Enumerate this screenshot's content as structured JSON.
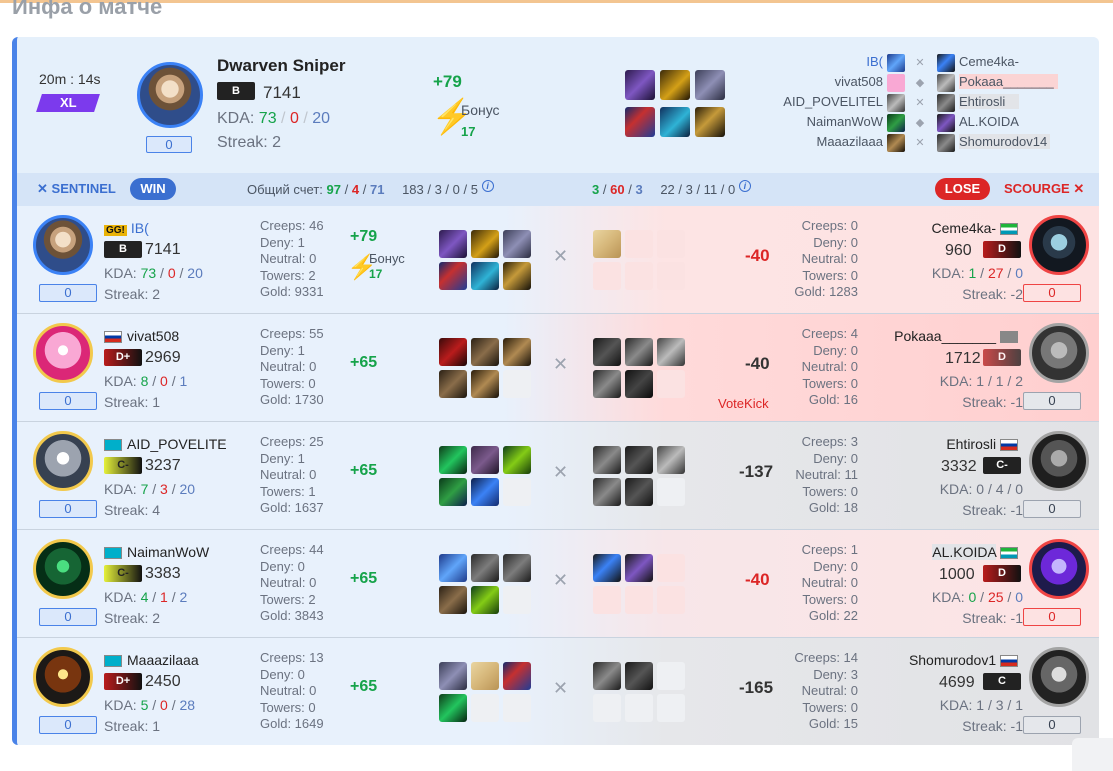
{
  "page_title": "Инфа о матче",
  "summary": {
    "time": "20m : 14s",
    "xl_badge": "XL",
    "hero_name": "Dwarven Sniper",
    "rank_letter": "B",
    "mmr": "7141",
    "kda_label": "KDA:",
    "kda_k": "73",
    "kda_d": "0",
    "kda_a": "20",
    "sep": "/",
    "streak": "Streak: 2",
    "value_box": "0",
    "delta": "+79",
    "bonus_label": "Бонус",
    "bonus_value": "17"
  },
  "roster": {
    "left": [
      "IB(",
      "vivat508",
      "AID_POVELITEL",
      "NaimanWoW",
      "Maaazilaaa"
    ],
    "right": [
      "Ceme4ka-",
      "Pokaaa_______",
      "Ehtirosli",
      "AL.KOIDA",
      "Shomurodov14"
    ]
  },
  "teambar": {
    "left_team": "SENTINEL",
    "win": "WIN",
    "total_label": "Общий счет:",
    "s_k": "97",
    "s_d": "4",
    "s_a": "71",
    "s_extra": "183 / 3 / 0 / 5",
    "o_k": "3",
    "o_d": "60",
    "o_a": "3",
    "o_extra": "22 / 3 / 11 / 0",
    "lose": "LOSE",
    "right_team": "SCOURGE",
    "info": "i"
  },
  "rows": [
    {
      "left": {
        "name": "IB(",
        "tag": "GG!",
        "rank": "B",
        "mmr": "7141",
        "k": "73",
        "d": "0",
        "a": "20",
        "streak": "Streak: 2",
        "box": "0",
        "creeps": "Creeps: 46",
        "deny": "Deny: 1",
        "neutral": "Neutral: 0",
        "towers": "Towers: 2",
        "gold": "Gold: 9331"
      },
      "delta_left": "+79",
      "bonus_label": "Бонус",
      "bonus_value": "17",
      "delta_right": "-40",
      "right": {
        "name": "Ceme4ka-",
        "rank": "D",
        "mmr": "960",
        "k": "1",
        "d": "27",
        "a": "0",
        "streak": "Streak: -2",
        "box": "0",
        "creeps": "Creeps: 0",
        "deny": "Deny: 0",
        "neutral": "Neutral: 0",
        "towers": "Towers: 0",
        "gold": "Gold: 1283"
      }
    },
    {
      "left": {
        "name": "vivat508",
        "rank": "D+",
        "mmr": "2969",
        "k": "8",
        "d": "0",
        "a": "1",
        "streak": "Streak: 1",
        "box": "0",
        "creeps": "Creeps: 55",
        "deny": "Deny: 1",
        "neutral": "Neutral: 0",
        "towers": "Towers: 0",
        "gold": "Gold: 1730"
      },
      "delta_left": "+65",
      "delta_right": "-40",
      "votekick": "VoteKick",
      "right": {
        "name": "Pokaaa_______",
        "rank": "D",
        "mmr": "1712",
        "k": "1",
        "d": "1",
        "a": "2",
        "streak": "Streak: -1",
        "box": "0",
        "creeps": "Creeps: 4",
        "deny": "Deny: 0",
        "neutral": "Neutral: 0",
        "towers": "Towers: 0",
        "gold": "Gold: 16"
      }
    },
    {
      "left": {
        "name": "AID_POVELITE",
        "rank": "C-",
        "mmr": "3237",
        "k": "7",
        "d": "3",
        "a": "20",
        "streak": "Streak: 4",
        "box": "0",
        "creeps": "Creeps: 25",
        "deny": "Deny: 1",
        "neutral": "Neutral: 0",
        "towers": "Towers: 1",
        "gold": "Gold: 1637"
      },
      "delta_left": "+65",
      "delta_right": "-137",
      "right": {
        "name": "Ehtirosli",
        "rank": "C-",
        "mmr": "3332",
        "k": "0",
        "d": "4",
        "a": "0",
        "streak": "Streak: -1",
        "box": "0",
        "creeps": "Creeps: 3",
        "deny": "Deny: 0",
        "neutral": "Neutral: 11",
        "towers": "Towers: 0",
        "gold": "Gold: 18"
      }
    },
    {
      "left": {
        "name": "NaimanWoW",
        "rank": "C-",
        "mmr": "3383",
        "k": "4",
        "d": "1",
        "a": "2",
        "streak": "Streak: 2",
        "box": "0",
        "creeps": "Creeps: 44",
        "deny": "Deny: 0",
        "neutral": "Neutral: 0",
        "towers": "Towers: 2",
        "gold": "Gold: 3843"
      },
      "delta_left": "+65",
      "delta_right": "-40",
      "right": {
        "name": "AL.KOIDA",
        "rank": "D",
        "mmr": "1000",
        "k": "0",
        "d": "25",
        "a": "0",
        "streak": "Streak: -1",
        "box": "0",
        "creeps": "Creeps: 1",
        "deny": "Deny: 0",
        "neutral": "Neutral: 0",
        "towers": "Towers: 0",
        "gold": "Gold: 22"
      }
    },
    {
      "left": {
        "name": "Maaazilaaa",
        "rank": "D+",
        "mmr": "2450",
        "k": "5",
        "d": "0",
        "a": "28",
        "streak": "Streak: 1",
        "box": "0",
        "creeps": "Creeps: 13",
        "deny": "Deny: 0",
        "neutral": "Neutral: 0",
        "towers": "Towers: 0",
        "gold": "Gold: 1649"
      },
      "delta_left": "+65",
      "delta_right": "-165",
      "right": {
        "name": "Shomurodov1",
        "rank": "C",
        "mmr": "4699",
        "k": "1",
        "d": "3",
        "a": "1",
        "streak": "Streak: -1",
        "box": "0",
        "creeps": "Creeps: 14",
        "deny": "Deny: 3",
        "neutral": "Neutral: 0",
        "towers": "Towers: 0",
        "gold": "Gold: 15"
      }
    }
  ]
}
